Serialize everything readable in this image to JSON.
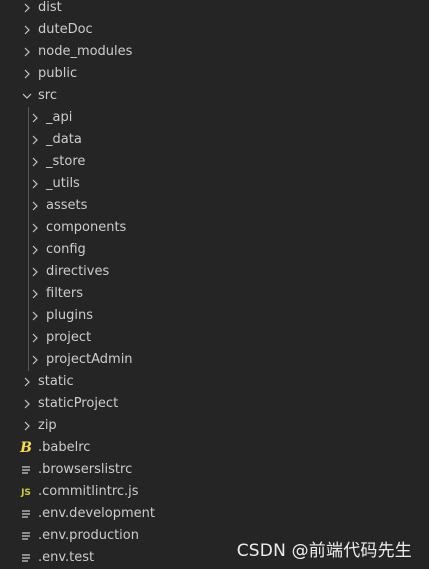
{
  "explorer": {
    "root_folders_top": [
      {
        "label": "dist",
        "expanded": false
      },
      {
        "label": "duteDoc",
        "expanded": false
      },
      {
        "label": "node_modules",
        "expanded": false
      },
      {
        "label": "public",
        "expanded": false
      }
    ],
    "src_folder": {
      "label": "src",
      "expanded": true,
      "children": [
        {
          "label": "_api",
          "expanded": false
        },
        {
          "label": "_data",
          "expanded": false
        },
        {
          "label": "_store",
          "expanded": false
        },
        {
          "label": "_utils",
          "expanded": false
        },
        {
          "label": "assets",
          "expanded": false
        },
        {
          "label": "components",
          "expanded": false
        },
        {
          "label": "config",
          "expanded": false
        },
        {
          "label": "directives",
          "expanded": false
        },
        {
          "label": "filters",
          "expanded": false
        },
        {
          "label": "plugins",
          "expanded": false
        },
        {
          "label": "project",
          "expanded": false
        },
        {
          "label": "projectAdmin",
          "expanded": false
        }
      ]
    },
    "root_folders_bottom": [
      {
        "label": "static",
        "expanded": false
      },
      {
        "label": "staticProject",
        "expanded": false
      },
      {
        "label": "zip",
        "expanded": false
      }
    ],
    "root_files": [
      {
        "label": ".babelrc",
        "icon": "babel-icon"
      },
      {
        "label": ".browserslistrc",
        "icon": "config-file-icon"
      },
      {
        "label": ".commitlintrc.js",
        "icon": "javascript-file-icon"
      },
      {
        "label": ".env.development",
        "icon": "config-file-icon"
      },
      {
        "label": ".env.production",
        "icon": "config-file-icon"
      },
      {
        "label": ".env.test",
        "icon": "config-file-icon"
      }
    ]
  },
  "icon_glyphs": {
    "babel": "B",
    "javascript": "JS"
  },
  "watermark": "CSDN @前端代码先生",
  "colors": {
    "background": "#252526",
    "text": "#cccccc",
    "chevron": "#c5c5c5",
    "indent_guide": "#585858",
    "babel_icon": "#f5da55",
    "js_icon": "#cbcb41",
    "config_icon": "#c5c5c5"
  }
}
